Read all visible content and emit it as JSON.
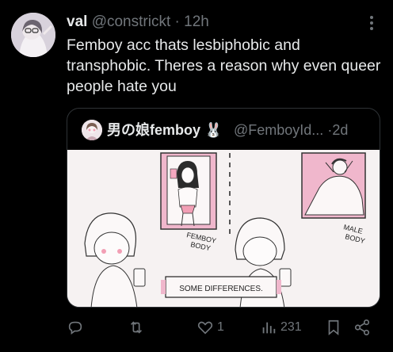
{
  "tweet": {
    "author_name": "val",
    "author_handle": "@constrickt",
    "separator": "·",
    "time": "12h",
    "text": "Femboy acc thats lesbiphobic and transphobic. Theres a reason why even queer people hate you"
  },
  "quote": {
    "author_name": "男の娘femboy 🐰",
    "author_handle": "@FemboyId...",
    "separator": "·",
    "time": "2d",
    "image_labels": {
      "femboy_body": "FEMBOY BODY",
      "male_body": "MALE BODY",
      "caption": "SOME DIFFERENCES."
    }
  },
  "actions": {
    "reply_count": "",
    "retweet_count": "",
    "like_count": "1",
    "views_count": "231"
  },
  "icons": [
    "more-icon",
    "reply-icon",
    "retweet-icon",
    "like-icon",
    "views-icon",
    "bookmark-icon",
    "share-icon"
  ],
  "colors": {
    "background": "#000000",
    "text": "#e7e9ea",
    "muted": "#71767b",
    "border": "#2f3336"
  }
}
